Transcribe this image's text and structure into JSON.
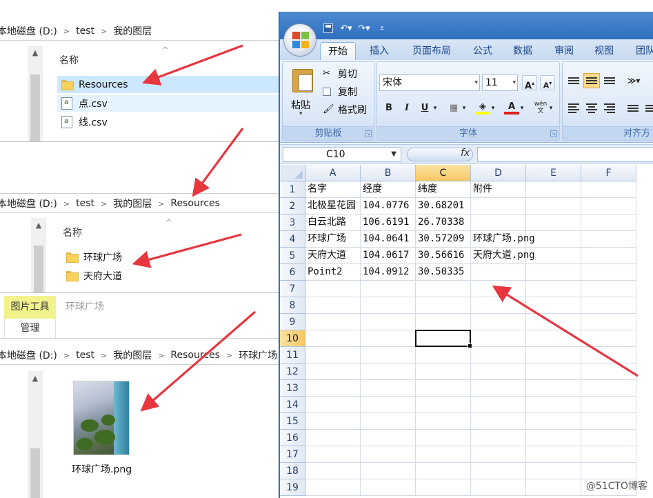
{
  "explorer_top": {
    "breadcrumb": [
      "本地磁盘 (D:)",
      "test",
      "我的图层"
    ],
    "column_name": "名称",
    "items": [
      {
        "name": "Resources",
        "type": "folder",
        "state": "selected"
      },
      {
        "name": "点.csv",
        "type": "csv",
        "state": "hover"
      },
      {
        "name": "线.csv",
        "type": "csv",
        "state": "normal"
      }
    ]
  },
  "explorer_mid": {
    "breadcrumb": [
      "本地磁盘 (D:)",
      "test",
      "我的图层",
      "Resources"
    ],
    "column_name": "名称",
    "items": [
      {
        "name": "环球广场",
        "type": "folder"
      },
      {
        "name": "天府大道",
        "type": "folder"
      }
    ]
  },
  "explorer_bottom": {
    "tool_tab": "图片工具",
    "context_title": "环球广场",
    "manage_tab": "管理",
    "breadcrumb": [
      "本地磁盘 (D:)",
      "test",
      "我的图层",
      "Resources",
      "环球广场"
    ],
    "file_name": "环球广场.png"
  },
  "excel": {
    "tabs": [
      "开始",
      "插入",
      "页面布局",
      "公式",
      "数据",
      "审阅",
      "视图",
      "团队"
    ],
    "clipboard": {
      "paste": "粘贴",
      "cut": "剪切",
      "copy": "复制",
      "format_painter": "格式刷",
      "group_label": "剪贴板"
    },
    "font": {
      "name": "宋体",
      "size": "11",
      "group_label": "字体",
      "grow": "A",
      "shrink": "A",
      "bold": "B",
      "italic": "I",
      "underline": "U",
      "font_color": "A",
      "phonetic": "wén"
    },
    "alignment": {
      "group_label": "对齐方"
    },
    "name_box": "C10",
    "fx": "fx",
    "columns": [
      "A",
      "B",
      "C",
      "D",
      "E",
      "F"
    ],
    "active_column": "C",
    "rows": [
      "1",
      "2",
      "3",
      "4",
      "5",
      "6",
      "7",
      "8",
      "9",
      "10",
      "11",
      "12",
      "13",
      "14",
      "15",
      "16",
      "17",
      "18",
      "19"
    ],
    "active_row": "10",
    "table": [
      [
        "名字",
        "经度",
        "纬度",
        "附件"
      ],
      [
        "北极星花园",
        "104.0776",
        "30.68201",
        ""
      ],
      [
        "白云北路",
        "106.6191",
        "26.70338",
        ""
      ],
      [
        "环球广场",
        "104.0641",
        "30.57209",
        "环球广场.png"
      ],
      [
        "天府大道",
        "104.0617",
        "30.56616",
        "天府大道.png"
      ],
      [
        "Point2",
        "104.0912",
        "30.50335",
        ""
      ]
    ]
  },
  "watermark": "@51CTO博客",
  "colors": {
    "arrow": "#e8363f",
    "excel_blue": "#2f6fbd",
    "selected_row": "#cce8ff"
  }
}
